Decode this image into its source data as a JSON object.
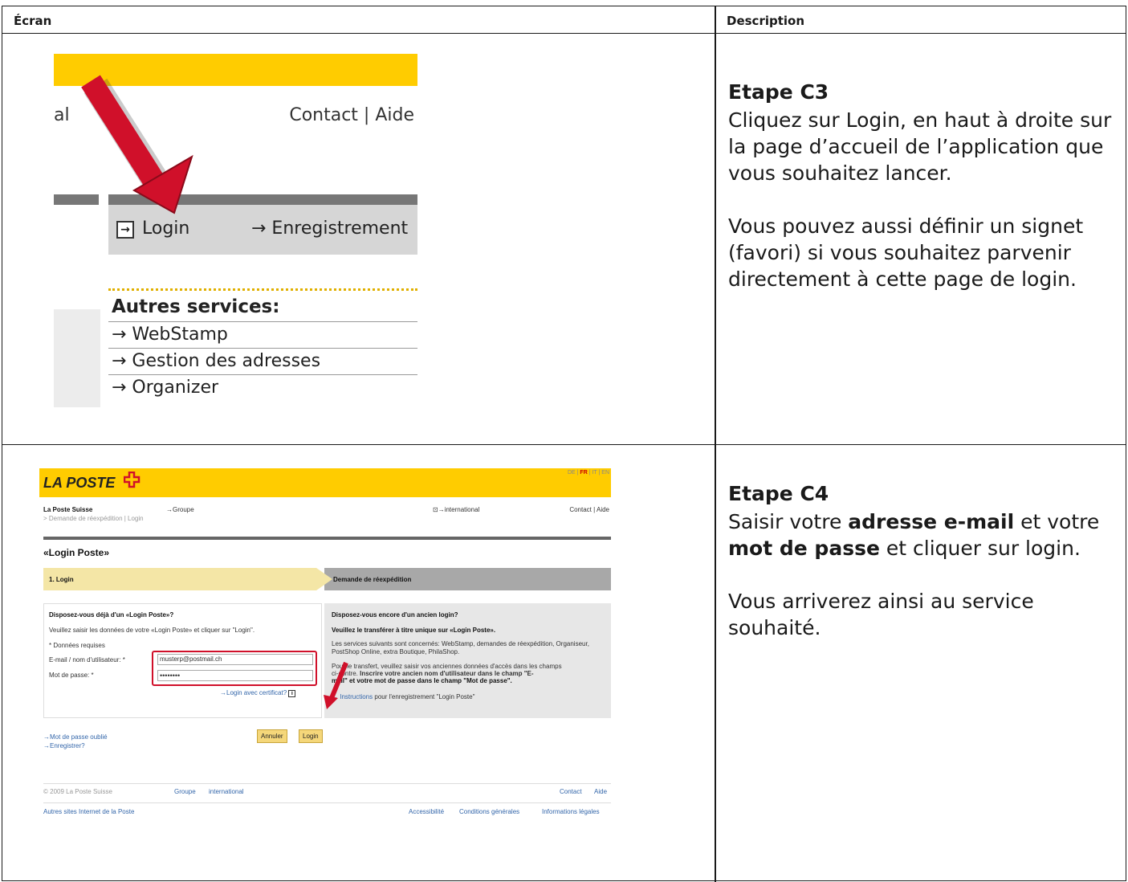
{
  "header": {
    "col_screen": "Écran",
    "col_description": "Description"
  },
  "step_c3": {
    "title": "Etape C3",
    "para1": "Cliquez sur Login, en haut à droite sur la page d’accueil de l’application que vous souhaitez lancer.",
    "para2": "Vous pouvez aussi définir un signet (favori) si vous souhaitez parvenir directement à cette page de login."
  },
  "shot1": {
    "nav_fragment": "al",
    "contact": "Contact | Aide",
    "login": "Login",
    "register": "→ Enregistrement",
    "other_services": "Autres services:",
    "links": [
      "→ WebStamp",
      "→ Gestion des adresses",
      "→ Organizer"
    ],
    "colors": {
      "yellow": "#ffcc00",
      "arrow": "#d0102a"
    }
  },
  "step_c4": {
    "title": "Etape C4",
    "para1_a": "Saisir votre ",
    "para1_b": "adresse e-mail",
    "para1_c": " et votre ",
    "para1_d": "mot de passe",
    "para1_e": " et cliquer sur login.",
    "para2": "Vous arriverez ainsi au service souhaité."
  },
  "shot2": {
    "logo": "LA POSTE",
    "lang_de": "DE | ",
    "lang_fr": "FR",
    "lang_rest": " | IT | EN",
    "nav_brand": "La Poste Suisse",
    "nav_groupe": "→Groupe",
    "nav_international": "⊡→international",
    "nav_contact": "Contact | Aide",
    "breadcrumb": "> Demande de réexpédition | Login",
    "page_title": "«Login Poste»",
    "step1": "1. Login",
    "step2": "Demande de réexpédition",
    "left_heading": "Disposez-vous déjà d'un «Login Poste»?",
    "left_intro": "Veuillez saisir les données de votre «Login Poste» et cliquer sur \"Login\".",
    "required": "* Données requises",
    "email_label": "E-mail / nom d'utilisateur: *",
    "password_label": "Mot de passe: *",
    "email_value": "musterp@postmail.ch",
    "password_value": "••••••••",
    "cert_link": "→Login avec certificat?",
    "info_icon": "i",
    "right_heading": "Disposez-vous encore d'un ancien login?",
    "right_bold": "Veuillez le transférer à titre unique sur «Login Poste».",
    "right_services": "Les services suivants sont concernés: WebStamp, demandes de réexpédition, Organiseur, PostShop Online, extra Boutique, PhilaShop.",
    "right_transfer_1": "Pour le transfert, veuillez saisir vos anciennes données d'accès dans les champs",
    "right_transfer_2a": "ci-contre. ",
    "right_transfer_2b": "Inscrire votre ancien nom d'utilisateur dans le champ \"E-",
    "right_transfer_3": "mail\" et votre mot de passe dans le champ \"Mot de passe\".",
    "instructions_link": "→ Instructions",
    "instructions_rest": " pour l'enregistrement \"Login Poste\"",
    "forgot": "→Mot de passe oublié",
    "register": "→Enregistrer?",
    "btn_cancel": "Annuler",
    "btn_login": "Login",
    "footer_copy": "© 2009 La Poste Suisse",
    "footer_groupe": "Groupe",
    "footer_international": "international",
    "footer_contact": "Contact",
    "footer_aide": "Aide",
    "footer_other": "Autres sites Internet de la Poste",
    "footer_access": "Accessibilité",
    "footer_conditions": "Conditions générales",
    "footer_legal": "Informations légales"
  }
}
